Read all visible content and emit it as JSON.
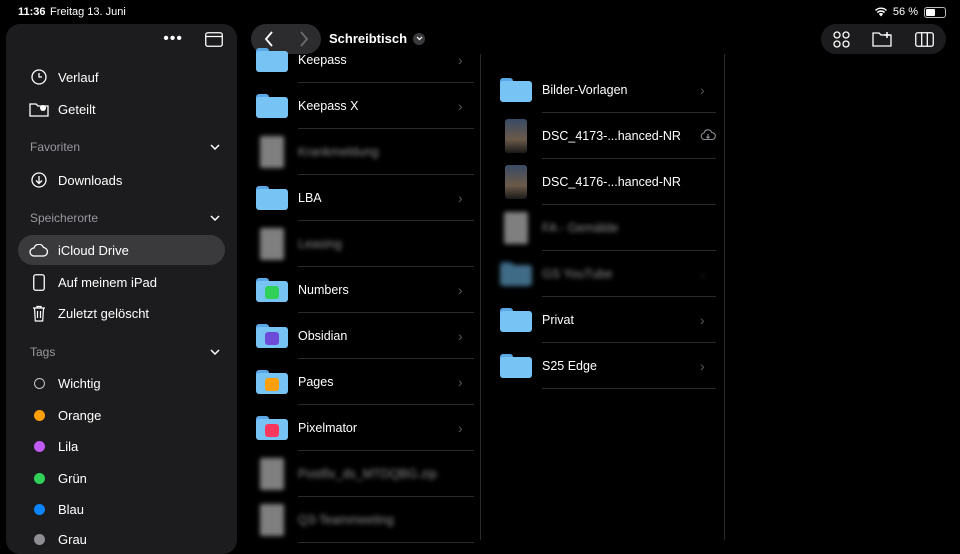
{
  "status": {
    "time": "11:36",
    "date": "Freitag 13. Juni",
    "battery": "56 %",
    "battery_level": 0.56
  },
  "sidebar": {
    "top_items": [
      {
        "label": "Verlauf",
        "icon": "clock-icon"
      },
      {
        "label": "Geteilt",
        "icon": "shared-folder-icon"
      }
    ],
    "favorites": {
      "title": "Favoriten",
      "items": [
        {
          "label": "Downloads",
          "icon": "download-icon"
        }
      ]
    },
    "locations": {
      "title": "Speicherorte",
      "items": [
        {
          "label": "iCloud Drive",
          "icon": "cloud-icon",
          "active": true
        },
        {
          "label": "Auf meinem iPad",
          "icon": "ipad-icon"
        },
        {
          "label": "Zuletzt gelöscht",
          "icon": "trash-icon"
        }
      ]
    },
    "tags": {
      "title": "Tags",
      "items": [
        {
          "label": "Wichtig",
          "color": ""
        },
        {
          "label": "Orange",
          "color": "#ff9f0a"
        },
        {
          "label": "Lila",
          "color": "#bf5af2"
        },
        {
          "label": "Grün",
          "color": "#30d158"
        },
        {
          "label": "Blau",
          "color": "#0a84ff"
        },
        {
          "label": "Grau",
          "color": "#8e8e93"
        }
      ]
    }
  },
  "toolbar": {
    "title": "Schreibtisch"
  },
  "column1": [
    {
      "name": "Keepass",
      "type": "folder",
      "chevron": true
    },
    {
      "name": "Keepass X",
      "type": "folder",
      "chevron": true
    },
    {
      "name": "Krankmeldung",
      "type": "doc",
      "blurred": true
    },
    {
      "name": "LBA",
      "type": "folder",
      "chevron": true
    },
    {
      "name": "Leasing",
      "type": "doc",
      "blurred": true
    },
    {
      "name": "Numbers",
      "type": "folder",
      "badge": "#30d158",
      "chevron": true
    },
    {
      "name": "Obsidian",
      "type": "folder",
      "badge": "#6e4bd8",
      "chevron": true
    },
    {
      "name": "Pages",
      "type": "folder",
      "badge": "#ff9f0a",
      "chevron": true
    },
    {
      "name": "Pixelmator",
      "type": "folder",
      "badge": "#ff375f",
      "chevron": true
    },
    {
      "name": "Postfix_ds_MTDQBG.zip",
      "type": "doc",
      "blurred": true
    },
    {
      "name": "Q3-Teammeeting",
      "type": "doc",
      "blurred": true
    }
  ],
  "column2": [
    {
      "name": "Bilder-Vorlagen",
      "type": "folder",
      "chevron": true
    },
    {
      "name": "DSC_4173-...hanced-NR",
      "type": "photo",
      "cloud": true
    },
    {
      "name": "DSC_4176-...hanced-NR",
      "type": "photo"
    },
    {
      "name": "FA - Gemälde",
      "type": "doc",
      "blurred": true
    },
    {
      "name": "GS YouTube",
      "type": "folder",
      "blurred": true,
      "chevron": true
    },
    {
      "name": "Privat",
      "type": "folder",
      "chevron": true
    },
    {
      "name": "S25 Edge",
      "type": "folder",
      "chevron": true
    }
  ]
}
